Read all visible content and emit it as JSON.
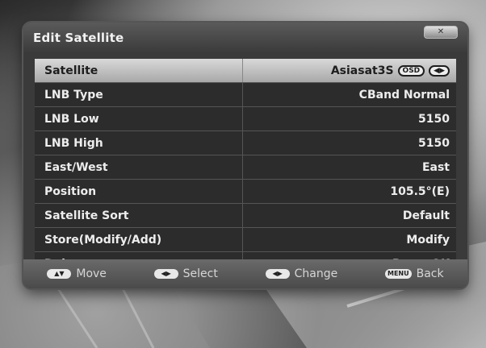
{
  "window": {
    "title": "Edit Satellite",
    "close_label": "✕"
  },
  "rows": [
    {
      "label": "Satellite",
      "value": "Asiasat3S",
      "badges": [
        "OSD",
        "◀▶"
      ]
    },
    {
      "label": "LNB Type",
      "value": "CBand Normal"
    },
    {
      "label": "LNB Low",
      "value": "5150"
    },
    {
      "label": "LNB High",
      "value": "5150"
    },
    {
      "label": "East/West",
      "value": "East"
    },
    {
      "label": "Position",
      "value": "105.5°(E)"
    },
    {
      "label": "Satellite Sort",
      "value": "Default"
    },
    {
      "label": "Store(Modify/Add)",
      "value": "Modify"
    },
    {
      "label": "Delete",
      "value": "Press OK"
    }
  ],
  "footer": {
    "move": {
      "key": "▲▼",
      "label": "Move"
    },
    "select": {
      "key": "◀▶",
      "label": "Select"
    },
    "change": {
      "key": "◀▶",
      "label": "Change"
    },
    "back": {
      "key": "MENU",
      "label": "Back"
    }
  }
}
